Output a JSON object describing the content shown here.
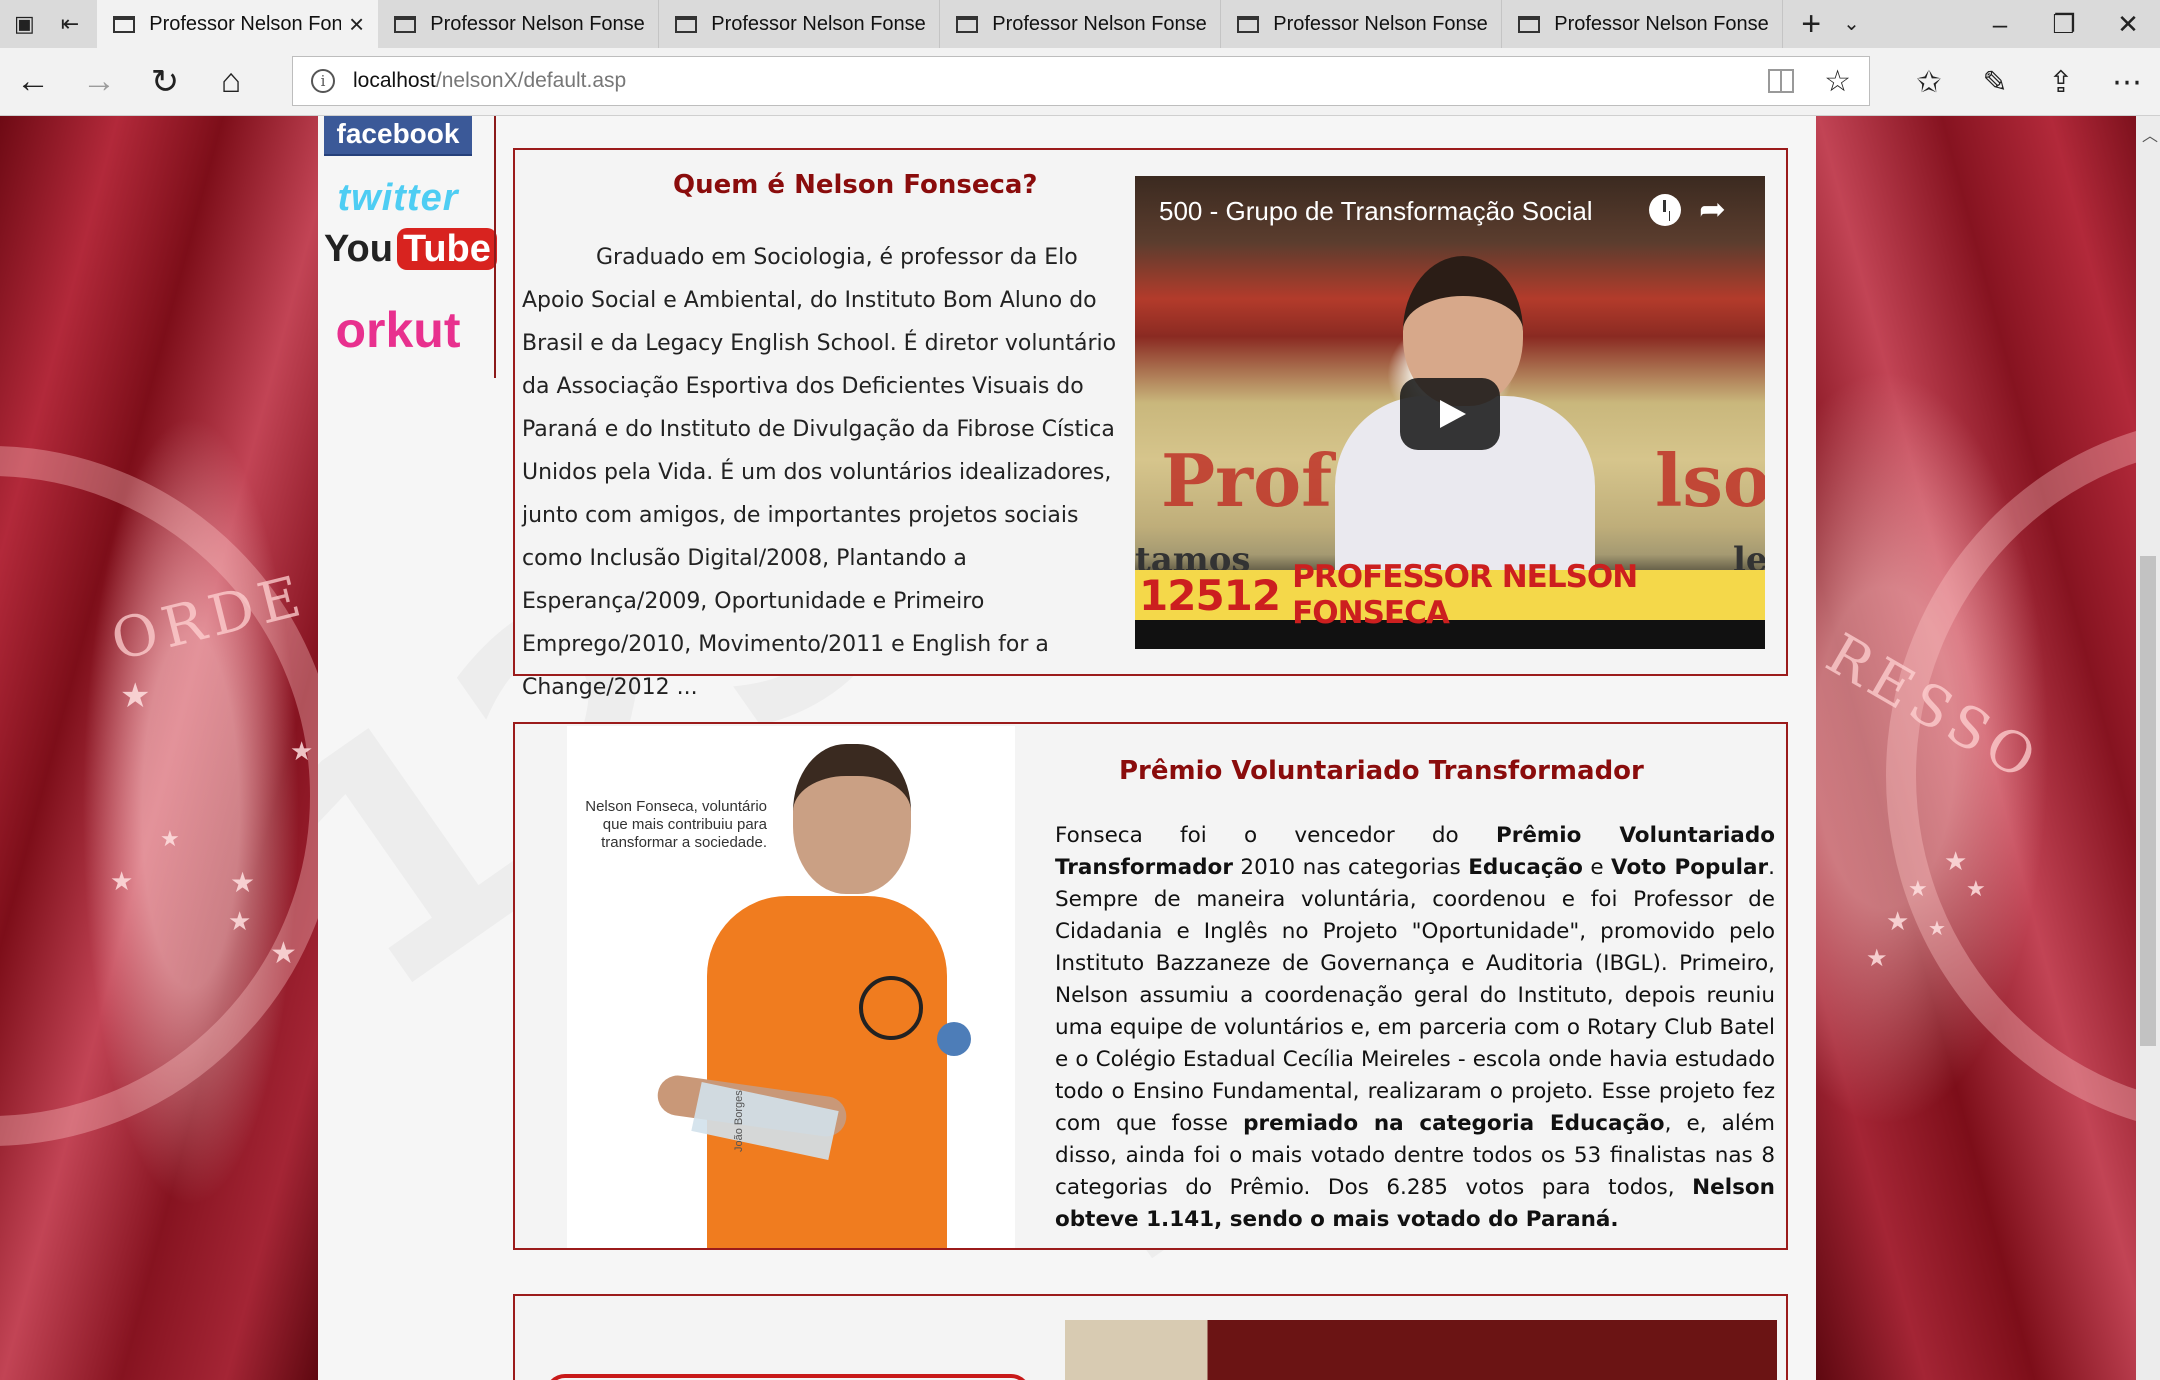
{
  "browser": {
    "tabs": [
      {
        "title": "Professor Nelson Fon",
        "active": true
      },
      {
        "title": "Professor Nelson Fonseca",
        "active": false
      },
      {
        "title": "Professor Nelson Fonseca",
        "active": false
      },
      {
        "title": "Professor Nelson Fonseca",
        "active": false
      },
      {
        "title": "Professor Nelson Fonseca",
        "active": false
      },
      {
        "title": "Professor Nelson Fonseca",
        "active": false
      }
    ],
    "url_host": "localhost",
    "url_path": "/nelsonX/default.asp"
  },
  "social": {
    "facebook": "facebook",
    "twitter": "twitter",
    "youtube_you": "You",
    "youtube_tube": "Tube",
    "orkut": "orkut"
  },
  "about": {
    "title": "Quem é Nelson Fonseca?",
    "text": "Graduado em Sociologia, é professor da Elo Apoio Social e Ambiental, do Instituto Bom Aluno do Brasil e da Legacy English School. É diretor voluntário da Associação Esportiva dos Deficientes Visuais do Paraná e do Instituto de Divulgação da Fibrose Cística Unidos pela Vida. É um dos voluntários idealizadores, junto com amigos, de importantes projetos sociais como Inclusão Digital/2008, Plantando a Esperança/2009, Oportunidade e Primeiro Emprego/2010, Movimento/2011 e English for a Change/2012 ..."
  },
  "video": {
    "title": "500 - Grupo de Transformação Social",
    "banner_number": "12512",
    "banner_name": "PROFESSOR NELSON FONSECA",
    "bg_word_left": "Prof",
    "bg_word_right": "lso",
    "bg_word_bottom": "tamos",
    "bg_word_bottom_right": "le"
  },
  "award": {
    "title": "Prêmio Voluntariado Transformador",
    "photo_caption": "Nelson Fonseca, voluntário que mais contribuiu para transformar a sociedade.",
    "photo_credit": "João Borges",
    "p1": "Fonseca foi o vencedor do ",
    "b1": "Prêmio Voluntariado Transformador",
    "p2": " 2010 nas categorias ",
    "b2": "Educação",
    "p3": " e ",
    "b3": "Voto Popular",
    "p4": ". Sempre de maneira voluntária, coordenou e foi Professor de Cidadania e Inglês no Projeto \"Oportunidade\", promovido pelo Instituto Bazzaneze de Governança e Auditoria (IBGL). Primeiro, Nelson assumiu a coordenação geral do Instituto, depois reuniu uma equipe de voluntários e, em parceria com o Rotary Club Batel e o Colégio Estadual Cecília Meireles - escola onde havia estudado todo o Ensino Fundamental, realizaram o projeto. Esse projeto fez com que fosse ",
    "b4": "premiado na categoria Educação",
    "p5": ", e, além disso, ainda foi o mais votado dentre todos os 53 finalistas nas 8 categorias do Prêmio. Dos 6.285 votos para todos, ",
    "b5": "Nelson obteve 1.141, sendo o mais votado do Paraná."
  },
  "flag": {
    "motto_left": "ORDE",
    "motto_right": "RESSO"
  },
  "colors": {
    "accent": "#8a0c0c",
    "border": "#9b1b1b"
  }
}
